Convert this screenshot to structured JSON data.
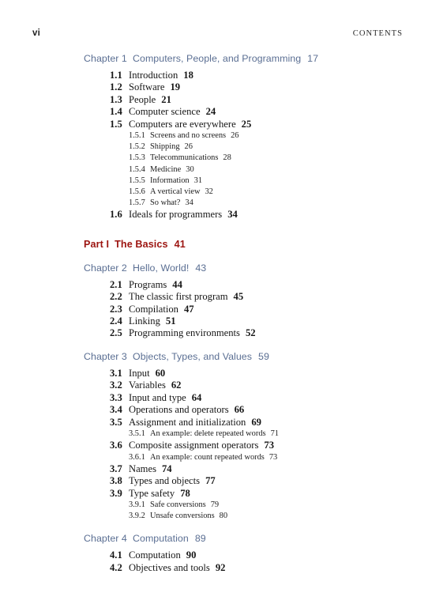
{
  "page": {
    "folio": "vi",
    "running_head": "CONTENTS",
    "colors": {
      "chapter": "#5b6f93",
      "part": "#9c1410",
      "body": "#161616",
      "background": "#ffffff"
    }
  },
  "toc": {
    "entries": [
      {
        "kind": "chapter",
        "label": "Chapter 1",
        "title": "Computers, People, and Programming",
        "page": "17"
      },
      {
        "kind": "section",
        "num": "1.1",
        "title": "Introduction",
        "page": "18"
      },
      {
        "kind": "section",
        "num": "1.2",
        "title": "Software",
        "page": "19"
      },
      {
        "kind": "section",
        "num": "1.3",
        "title": "People",
        "page": "21"
      },
      {
        "kind": "section",
        "num": "1.4",
        "title": "Computer science",
        "page": "24"
      },
      {
        "kind": "section",
        "num": "1.5",
        "title": "Computers are everywhere",
        "page": "25"
      },
      {
        "kind": "subsection",
        "num": "1.5.1",
        "title": "Screens and no screens",
        "page": "26"
      },
      {
        "kind": "subsection",
        "num": "1.5.2",
        "title": "Shipping",
        "page": "26"
      },
      {
        "kind": "subsection",
        "num": "1.5.3",
        "title": "Telecommunications",
        "page": "28"
      },
      {
        "kind": "subsection",
        "num": "1.5.4",
        "title": "Medicine",
        "page": "30"
      },
      {
        "kind": "subsection",
        "num": "1.5.5",
        "title": "Information",
        "page": "31"
      },
      {
        "kind": "subsection",
        "num": "1.5.6",
        "title": "A vertical view",
        "page": "32"
      },
      {
        "kind": "subsection",
        "num": "1.5.7",
        "title": "So what?",
        "page": "34"
      },
      {
        "kind": "section",
        "num": "1.6",
        "title": "Ideals for programmers",
        "page": "34"
      },
      {
        "kind": "part",
        "label": "Part I",
        "title": "The Basics",
        "page": "41"
      },
      {
        "kind": "chapter",
        "label": "Chapter 2",
        "title": "Hello, World!",
        "page": "43"
      },
      {
        "kind": "section",
        "num": "2.1",
        "title": "Programs",
        "page": "44"
      },
      {
        "kind": "section",
        "num": "2.2",
        "title": "The classic first program",
        "page": "45"
      },
      {
        "kind": "section",
        "num": "2.3",
        "title": "Compilation",
        "page": "47"
      },
      {
        "kind": "section",
        "num": "2.4",
        "title": "Linking",
        "page": "51"
      },
      {
        "kind": "section",
        "num": "2.5",
        "title": "Programming environments",
        "page": "52"
      },
      {
        "kind": "chapter",
        "label": "Chapter 3",
        "title": "Objects, Types, and Values",
        "page": "59"
      },
      {
        "kind": "section",
        "num": "3.1",
        "title": "Input",
        "page": "60"
      },
      {
        "kind": "section",
        "num": "3.2",
        "title": "Variables",
        "page": "62"
      },
      {
        "kind": "section",
        "num": "3.3",
        "title": "Input and type",
        "page": "64"
      },
      {
        "kind": "section",
        "num": "3.4",
        "title": "Operations and operators",
        "page": "66"
      },
      {
        "kind": "section",
        "num": "3.5",
        "title": "Assignment and initialization",
        "page": "69"
      },
      {
        "kind": "subsection",
        "num": "3.5.1",
        "title": "An example: delete repeated words",
        "page": "71"
      },
      {
        "kind": "section",
        "num": "3.6",
        "title": "Composite assignment operators",
        "page": "73"
      },
      {
        "kind": "subsection",
        "num": "3.6.1",
        "title": "An example: count repeated words",
        "page": "73"
      },
      {
        "kind": "section",
        "num": "3.7",
        "title": "Names",
        "page": "74"
      },
      {
        "kind": "section",
        "num": "3.8",
        "title": "Types and objects",
        "page": "77"
      },
      {
        "kind": "section",
        "num": "3.9",
        "title": "Type safety",
        "page": "78"
      },
      {
        "kind": "subsection",
        "num": "3.9.1",
        "title": "Safe conversions",
        "page": "79"
      },
      {
        "kind": "subsection",
        "num": "3.9.2",
        "title": "Unsafe conversions",
        "page": "80"
      },
      {
        "kind": "chapter",
        "label": "Chapter 4",
        "title": "Computation",
        "page": "89"
      },
      {
        "kind": "section",
        "num": "4.1",
        "title": "Computation",
        "page": "90"
      },
      {
        "kind": "section",
        "num": "4.2",
        "title": "Objectives and tools",
        "page": "92"
      }
    ]
  }
}
